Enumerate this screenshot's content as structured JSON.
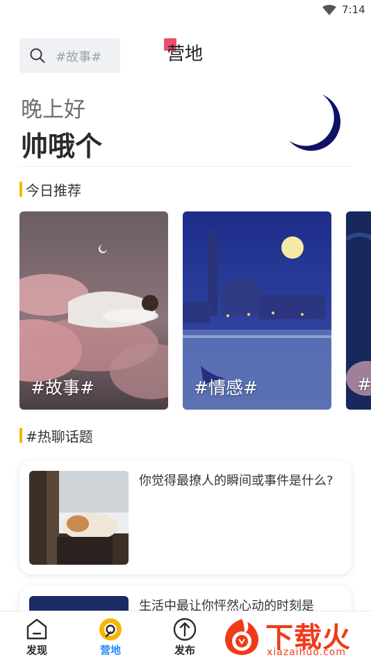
{
  "status_bar": {
    "time": "7:14"
  },
  "search": {
    "placeholder": "#故事#"
  },
  "header": {
    "title": "营地"
  },
  "greeting": {
    "text": "晚上好",
    "username": "帅哦个"
  },
  "recommend": {
    "title": "今日推荐",
    "cards": [
      {
        "tag": "#故事#"
      },
      {
        "tag": "#情感#"
      },
      {
        "tag": "#"
      }
    ]
  },
  "hot_topics": {
    "title": "#热聊话题",
    "items": [
      {
        "title": "你觉得最撩人的瞬间或事件是什么?"
      },
      {
        "title": "生活中最让你怦然心动的时刻是"
      }
    ]
  },
  "bottom_nav": {
    "items": [
      {
        "label": "发现"
      },
      {
        "label": "营地"
      },
      {
        "label": "发布"
      }
    ]
  },
  "watermark": {
    "text": "下载火",
    "url": "xiazaihuo.com"
  },
  "colors": {
    "accent_yellow": "#f7b500",
    "active_blue": "#2b8cff",
    "moon_navy": "#0f1166"
  }
}
